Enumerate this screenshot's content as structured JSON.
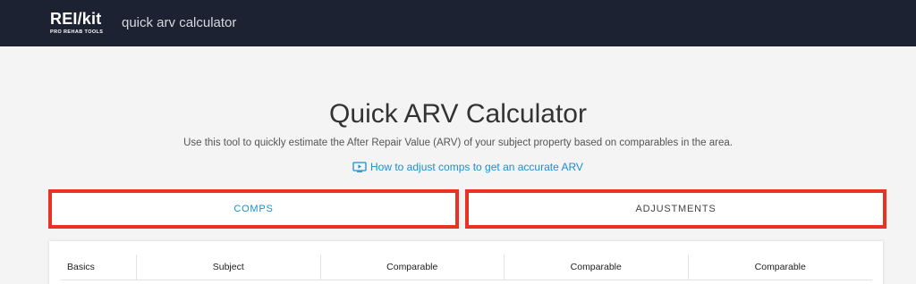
{
  "header": {
    "logo_main": "REI/kit",
    "logo_sub": "PRO REHAB TOOLS",
    "app_title": "quick arv calculator"
  },
  "main": {
    "title": "Quick ARV Calculator",
    "description": "Use this tool to quickly estimate the After Repair Value (ARV) of your subject property based on comparables in the area.",
    "help_link": "How to adjust comps to get an accurate ARV",
    "help_icon": "video-icon"
  },
  "tabs": [
    {
      "label": "COMPS",
      "active": true
    },
    {
      "label": "ADJUSTMENTS",
      "active": false
    }
  ],
  "table": {
    "headers": [
      "Basics",
      "Subject",
      "Comparable",
      "Comparable",
      "Comparable"
    ]
  },
  "colors": {
    "topbar": "#1d2233",
    "accent_blue": "#1a8fd1",
    "highlight_red": "#e83224"
  }
}
